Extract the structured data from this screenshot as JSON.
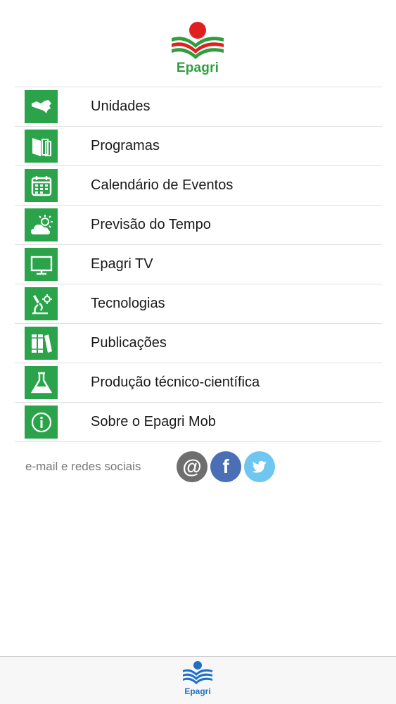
{
  "header": {
    "logo_text": "Epagri"
  },
  "menu": [
    {
      "label": "Unidades",
      "icon": "map-icon"
    },
    {
      "label": "Programas",
      "icon": "documents-icon"
    },
    {
      "label": "Calendário de Eventos",
      "icon": "calendar-icon"
    },
    {
      "label": "Previsão do Tempo",
      "icon": "weather-icon"
    },
    {
      "label": "Epagri TV",
      "icon": "tv-icon"
    },
    {
      "label": "Tecnologias",
      "icon": "microscope-icon"
    },
    {
      "label": "Publicações",
      "icon": "books-icon"
    },
    {
      "label": "Produção técnico-científica",
      "icon": "flask-icon"
    },
    {
      "label": "Sobre o Epagri Mob",
      "icon": "info-icon"
    }
  ],
  "social": {
    "label": "e-mail e redes sociais",
    "email_glyph": "@",
    "facebook_glyph": "f"
  },
  "tab_bar": {
    "logo_text": "Epagri"
  },
  "colors": {
    "icon_green": "#2aa34a",
    "logo_red": "#e02020",
    "logo_green": "#2e9e3e",
    "facebook": "#4a6fb5",
    "twitter": "#6fc6ee",
    "email": "#6e6e6e",
    "tab_blue": "#1e6fc8"
  }
}
